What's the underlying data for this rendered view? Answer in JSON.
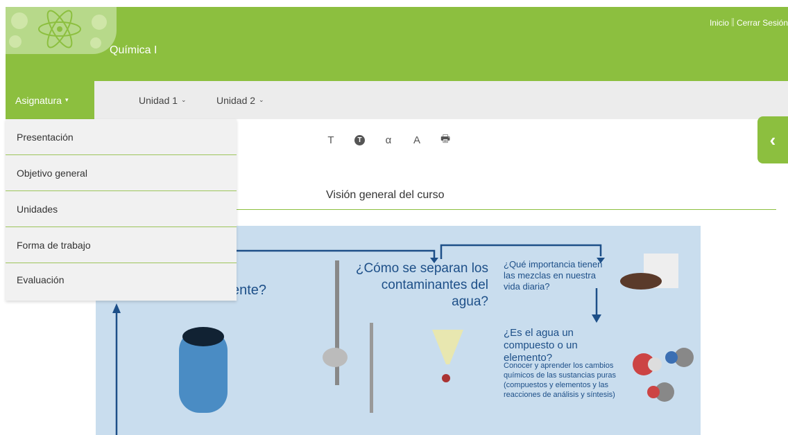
{
  "header": {
    "course_title": "Química I",
    "links": [
      "Inicio",
      "Cerrar Sesión"
    ]
  },
  "nav": {
    "active": "Asignatura",
    "items": [
      "Unidad 1",
      "Unidad 2"
    ]
  },
  "dropdown": {
    "items": [
      "Presentación",
      "Objetivo general",
      "Unidades",
      "Forma de trabajo",
      "Evaluación"
    ]
  },
  "toolbar": {
    "icons": [
      "text-size-icon",
      "text-style-icon",
      "font-icon",
      "increase-font-icon",
      "print-icon"
    ],
    "glyphs": [
      "T",
      "T",
      "α",
      "A",
      "🖶"
    ]
  },
  "main": {
    "section_title": "Visión general del curso"
  },
  "infographic": {
    "q_partial": "ente?",
    "q1": "¿Cómo se separan los contaminantes del agua?",
    "q2": "¿Qué importancia tienen las mezclas en nuestra vida diaria?",
    "q3": "¿Es el agua un compuesto o un elemento?",
    "q3_detail": "Conocer y aprender los cambios químicos de las sustancias puras (compuestos y elementos y las reacciones de análisis y síntesis)"
  },
  "colors": {
    "brand": "#8cbf3f",
    "infographic_bg": "#c9ddee",
    "infographic_text": "#1d4f88"
  }
}
